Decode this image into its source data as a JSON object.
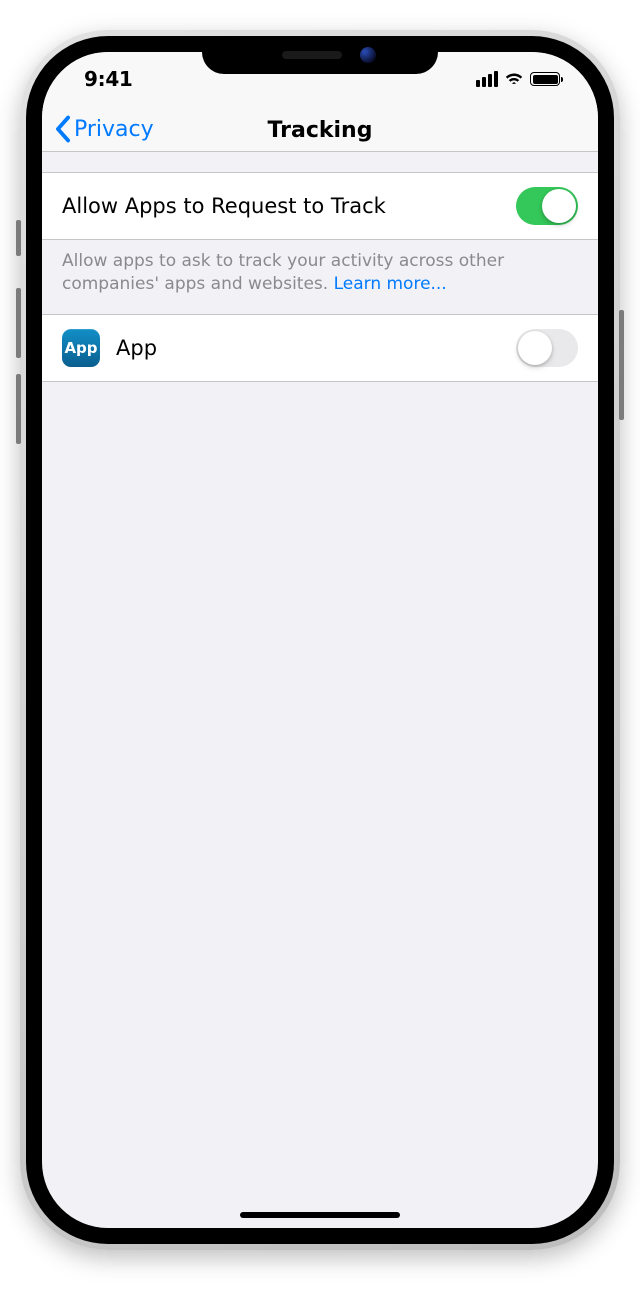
{
  "status_bar": {
    "time": "9:41"
  },
  "nav": {
    "back_label": "Privacy",
    "title": "Tracking"
  },
  "settings": {
    "allow_request": {
      "label": "Allow Apps to Request to Track",
      "enabled": true
    },
    "description": "Allow apps to ask to track your activity across other companies' apps and websites. ",
    "learn_more": "Learn more...",
    "apps": [
      {
        "icon_text": "App",
        "name": "App",
        "tracking_enabled": false
      }
    ]
  }
}
